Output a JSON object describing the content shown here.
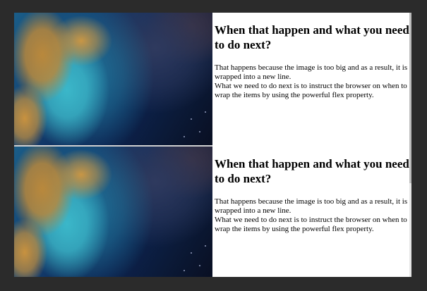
{
  "cards": [
    {
      "heading": "When that happen and what you need to do next?",
      "line1": "That happens because the image is too big and as a result, it is wrapped into a new line.",
      "line2": "What we need to do next is to instruct the browser on when to wrap the items by using the powerful flex property.",
      "image_subject": "satellite view of coastline and ocean"
    },
    {
      "heading": "When that happen and what you need to do next?",
      "line1": "That happens because the image is too big and as a result, it is wrapped into a new line.",
      "line2": "What we need to do next is to instruct the browser on when to wrap the items by using the powerful flex property.",
      "image_subject": "satellite view of coastline and ocean"
    }
  ]
}
